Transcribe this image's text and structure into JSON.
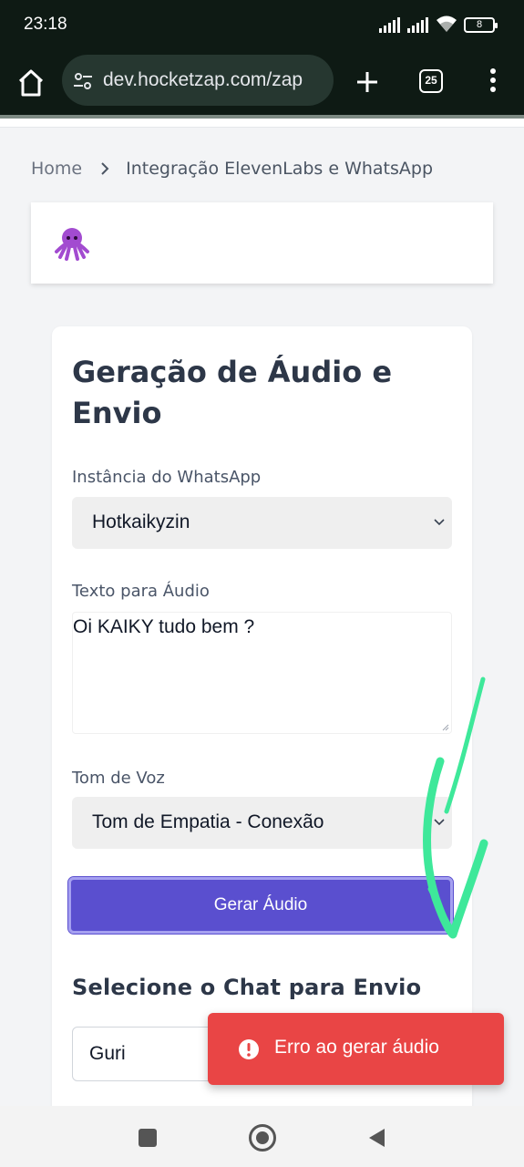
{
  "status_bar": {
    "time": "23:18",
    "battery": "8",
    "icons": [
      "signal-icon",
      "signal-icon",
      "wifi-icon",
      "battery-icon"
    ]
  },
  "browser": {
    "url": "dev.hocketzap.com/zap",
    "tab_count": "25",
    "icons": [
      "home-icon",
      "site-settings-icon",
      "plus-icon",
      "tabs-icon",
      "more-vertical-icon"
    ]
  },
  "breadcrumb": {
    "home": "Home",
    "current": "Integração ElevenLabs e WhatsApp"
  },
  "form": {
    "title": "Geração de Áudio e Envio",
    "instance_label": "Instância do WhatsApp",
    "instance_value": "Hotkaikyzin",
    "text_label": "Texto para Áudio",
    "text_value": "Oi KAIKY tudo bem ?",
    "voice_label": "Tom de Voz",
    "voice_value": "Tom de Empatia - Conexão",
    "generate_button": "Gerar Áudio",
    "chat_section_title": "Selecione o Chat para Envio",
    "chat_value": "Guri"
  },
  "toast": {
    "message": "Erro ao gerar áudio",
    "color": "#e94545"
  },
  "colors": {
    "primary": "#5a4fcf",
    "annotation": "#3ee89a",
    "browser_chrome": "#0e1a14"
  }
}
